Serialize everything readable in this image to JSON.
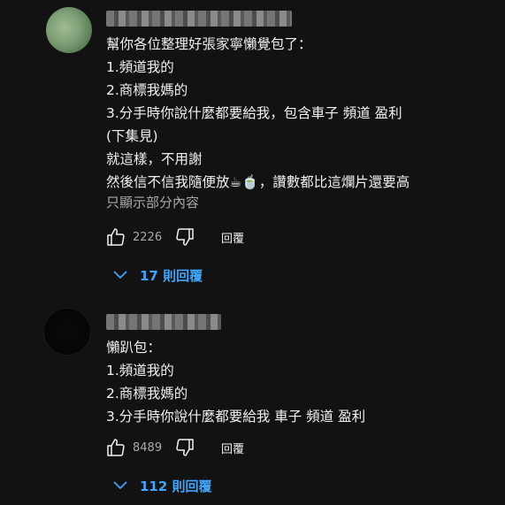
{
  "comments": [
    {
      "lines": [
        "幫你各位整理好張家寧懶覺包了：",
        "1.頻道我的",
        "2.商標我媽的",
        "3.分手時你說什麼都要給我，包含車子 頻道 盈利",
        "(下集見)",
        "就這樣，不用謝",
        "然後信不信我隨便放☕🍵，讚數都比這爛片還要高"
      ],
      "read_more": "只顯示部分內容",
      "likes": "2226",
      "reply_label": "回覆",
      "replies_label": "17 則回覆"
    },
    {
      "lines": [
        "懶趴包：",
        "1.頻道我的",
        "2.商標我媽的",
        "3.分手時你說什麼都要給我 車子 頻道 盈利"
      ],
      "likes": "8489",
      "reply_label": "回覆",
      "replies_label": "112 則回覆"
    }
  ],
  "colors": {
    "background": "#121212",
    "text": "#f1f1f1",
    "muted": "#aaaaaa",
    "link": "#3ea6ff"
  },
  "icons": [
    "thumbs-up-icon",
    "thumbs-down-icon",
    "chevron-down-icon"
  ]
}
